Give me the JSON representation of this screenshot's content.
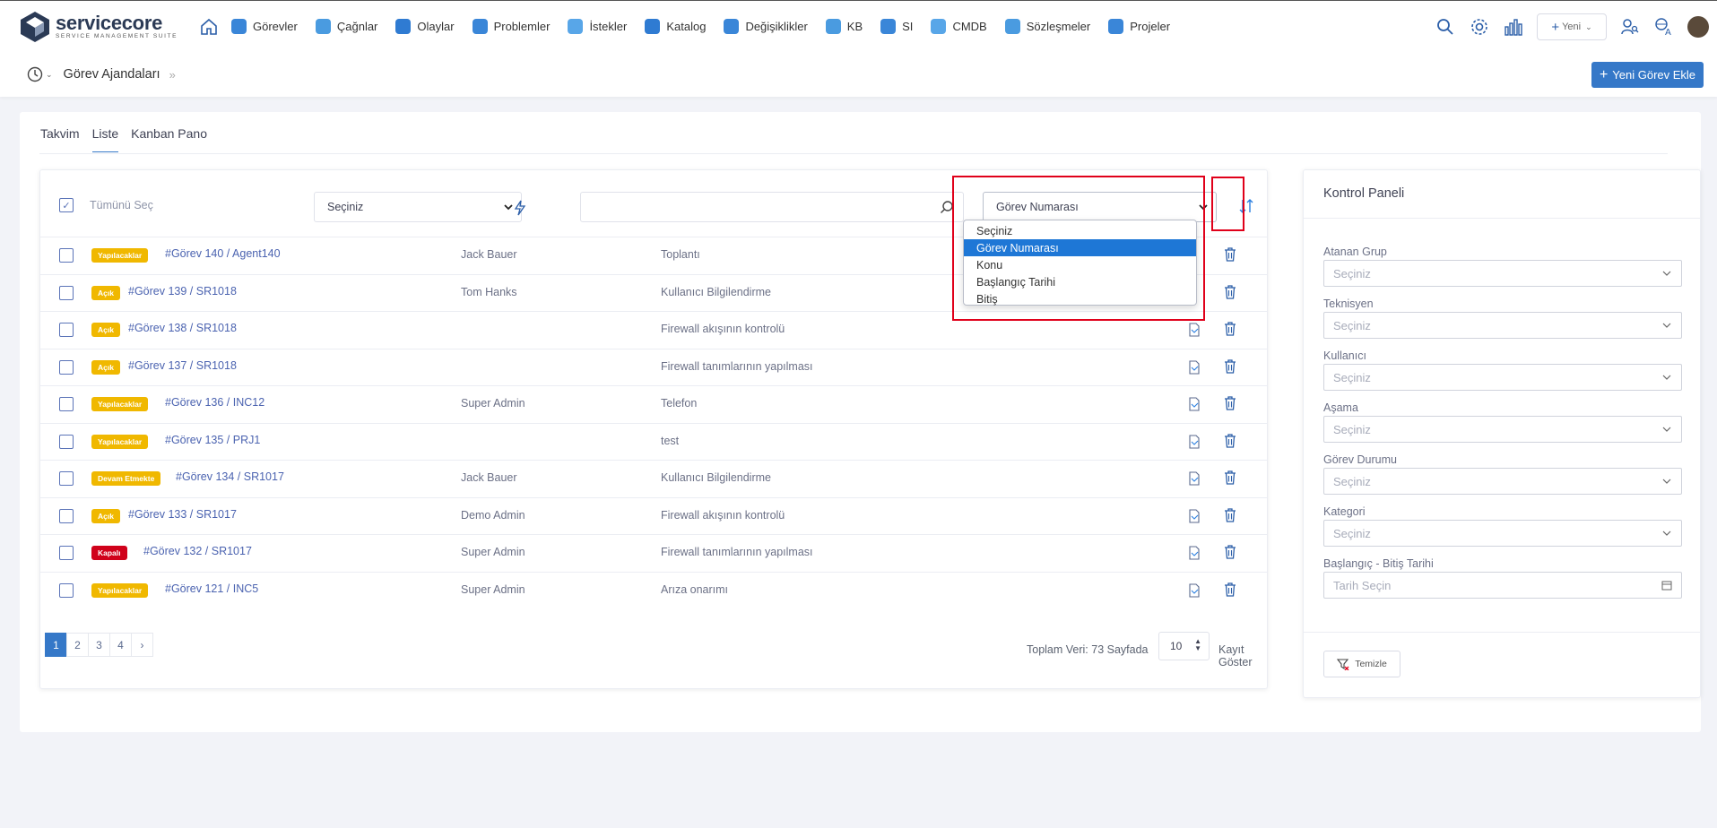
{
  "brand": {
    "name": "servicecore",
    "tagline": "SERVICE MANAGEMENT SUITE"
  },
  "nav": [
    {
      "label": "Görevler",
      "color": "#3a86d8"
    },
    {
      "label": "Çağnlar",
      "color": "#4a9be0"
    },
    {
      "label": "Olaylar",
      "color": "#2f7bd2"
    },
    {
      "label": "Problemler",
      "color": "#3a86d8"
    },
    {
      "label": "İstekler",
      "color": "#58a6e8"
    },
    {
      "label": "Katalog",
      "color": "#2f7bd2"
    },
    {
      "label": "Değişiklikler",
      "color": "#3a86d8"
    },
    {
      "label": "KB",
      "color": "#4a9be0"
    },
    {
      "label": "SI",
      "color": "#3a86d8"
    },
    {
      "label": "CMDB",
      "color": "#58a6e8"
    },
    {
      "label": "Sözleşmeler",
      "color": "#4a9be0"
    },
    {
      "label": "Projeler",
      "color": "#3a86d8"
    }
  ],
  "topright": {
    "new_label": "Yeni"
  },
  "subheader": {
    "title": "Görev Ajandaları",
    "add_button": "Yeni Görev Ekle"
  },
  "tabs": [
    "Takvim",
    "Liste",
    "Kanban Pano"
  ],
  "active_tab": "Liste",
  "toolbar": {
    "select_all": "Tümünü Seç",
    "filter_select": "Seçiniz",
    "search_value": "",
    "sort_select": "Görev Numarası"
  },
  "sort_options": [
    "Seçiniz",
    "Görev Numarası",
    "Konu",
    "Başlangıç Tarihi",
    "Bitiş"
  ],
  "sort_selected_index": 1,
  "rows": [
    {
      "status": "Yapılacaklar",
      "color": "#f0b800",
      "task": "#Görev 140 / Agent140",
      "person": "Jack Bauer",
      "subject": "Toplantı"
    },
    {
      "status": "Açık",
      "color": "#f0b800",
      "task": "#Görev 139 / SR1018",
      "person": "Tom Hanks",
      "subject": "Kullanıcı Bilgilendirme"
    },
    {
      "status": "Açık",
      "color": "#f0b800",
      "task": "#Görev 138 / SR1018",
      "person": "",
      "subject": "Firewall akışının kontrolü"
    },
    {
      "status": "Açık",
      "color": "#f0b800",
      "task": "#Görev 137 / SR1018",
      "person": "",
      "subject": "Firewall tanımlarının yapılması"
    },
    {
      "status": "Yapılacaklar",
      "color": "#f0b800",
      "task": "#Görev 136 / INC12",
      "person": "Super Admin",
      "subject": "Telefon"
    },
    {
      "status": "Yapılacaklar",
      "color": "#f0b800",
      "task": "#Görev 135 / PRJ1",
      "person": "",
      "subject": "test"
    },
    {
      "status": "Devam Etmekte",
      "color": "#f0b800",
      "task": "#Görev 134 / SR1017",
      "person": "Jack Bauer",
      "subject": "Kullanıcı Bilgilendirme"
    },
    {
      "status": "Açık",
      "color": "#f0b800",
      "task": "#Görev 133 / SR1017",
      "person": "Demo Admin",
      "subject": "Firewall akışının kontrolü"
    },
    {
      "status": "Kapalı",
      "color": "#d0021b",
      "task": "#Görev 132 / SR1017",
      "person": "Super Admin",
      "subject": "Firewall tanımlarının yapılması"
    },
    {
      "status": "Yapılacaklar",
      "color": "#f0b800",
      "task": "#Görev 121 / INC5",
      "person": "Super Admin",
      "subject": "Arıza onarımı"
    }
  ],
  "pagination": {
    "pages": [
      "1",
      "2",
      "3",
      "4"
    ],
    "next": "›",
    "active": "1"
  },
  "footer": {
    "total": "Toplam Veri: 73 Sayfada",
    "page_size": "10",
    "show_label": "Kayıt Göster"
  },
  "control_panel": {
    "title": "Kontrol Paneli",
    "fields": [
      {
        "label": "Atanan Grup",
        "placeholder": "Seçiniz"
      },
      {
        "label": "Teknisyen",
        "placeholder": "Seçiniz"
      },
      {
        "label": "Kullanıcı",
        "placeholder": "Seçiniz"
      },
      {
        "label": "Aşama",
        "placeholder": "Seçiniz"
      },
      {
        "label": "Görev Durumu",
        "placeholder": "Seçiniz"
      },
      {
        "label": "Kategori",
        "placeholder": "Seçiniz"
      },
      {
        "label": "Başlangıç - Bitiş Tarihi",
        "placeholder": "Tarih Seçin"
      }
    ],
    "clear_label": "Temizle"
  },
  "colors": {
    "accent": "#3578c8",
    "highlight": "#e0001a",
    "link": "#4b63b0"
  }
}
